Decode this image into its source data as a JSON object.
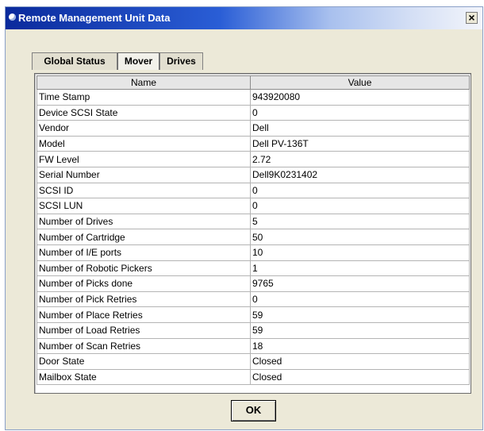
{
  "window": {
    "title": "Remote Management Unit Data",
    "close_label": "×"
  },
  "tabs": [
    {
      "label": "Global Status"
    },
    {
      "label": "Mover",
      "active": true
    },
    {
      "label": "Drives"
    }
  ],
  "table": {
    "columns": [
      "Name",
      "Value"
    ],
    "rows": [
      {
        "name": "Time Stamp",
        "value": "943920080"
      },
      {
        "name": "Device SCSI State",
        "value": "0"
      },
      {
        "name": "Vendor",
        "value": "Dell"
      },
      {
        "name": "Model",
        "value": "Dell PV-136T"
      },
      {
        "name": "FW Level",
        "value": "2.72"
      },
      {
        "name": "Serial Number",
        "value": "Dell9K0231402"
      },
      {
        "name": "SCSI ID",
        "value": "0"
      },
      {
        "name": "SCSI LUN",
        "value": "0"
      },
      {
        "name": "Number of Drives",
        "value": "5"
      },
      {
        "name": "Number of Cartridge",
        "value": "50"
      },
      {
        "name": "Number of I/E ports",
        "value": "10"
      },
      {
        "name": "Number of Robotic Pickers",
        "value": "1"
      },
      {
        "name": "Number of Picks done",
        "value": "9765"
      },
      {
        "name": "Number of Pick Retries",
        "value": "0"
      },
      {
        "name": "Number of Place Retries",
        "value": "59"
      },
      {
        "name": "Number of Load Retries",
        "value": "59"
      },
      {
        "name": "Number of Scan Retries",
        "value": "18"
      },
      {
        "name": "Door State",
        "value": "Closed"
      },
      {
        "name": "Mailbox State",
        "value": "Closed"
      }
    ]
  },
  "buttons": {
    "ok_label": "OK"
  }
}
